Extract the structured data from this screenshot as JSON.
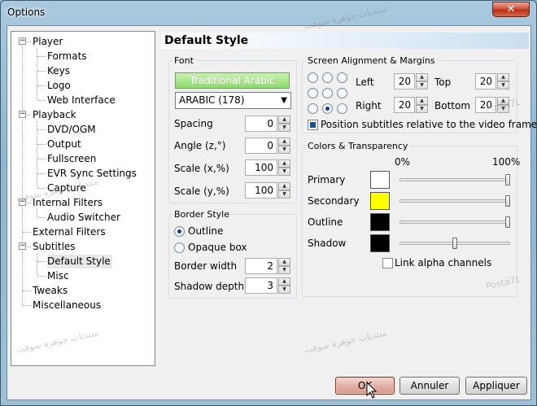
{
  "window": {
    "title": "Options",
    "close_label": "✕"
  },
  "tree": {
    "items": [
      {
        "label": "Player",
        "level": 0,
        "toggle": "−"
      },
      {
        "label": "Formats",
        "level": 1
      },
      {
        "label": "Keys",
        "level": 1
      },
      {
        "label": "Logo",
        "level": 1
      },
      {
        "label": "Web Interface",
        "level": 1
      },
      {
        "label": "Playback",
        "level": 0,
        "toggle": "−"
      },
      {
        "label": "DVD/OGM",
        "level": 1
      },
      {
        "label": "Output",
        "level": 1
      },
      {
        "label": "Fullscreen",
        "level": 1
      },
      {
        "label": "EVR Sync Settings",
        "level": 1
      },
      {
        "label": "Capture",
        "level": 1
      },
      {
        "label": "Internal Filters",
        "level": 0,
        "toggle": "−"
      },
      {
        "label": "Audio Switcher",
        "level": 1
      },
      {
        "label": "External Filters",
        "level": 0
      },
      {
        "label": "Subtitles",
        "level": 0,
        "toggle": "−"
      },
      {
        "label": "Default Style",
        "level": 1,
        "selected": true
      },
      {
        "label": "Misc",
        "level": 1
      },
      {
        "label": "Tweaks",
        "level": 0
      },
      {
        "label": "Miscellaneous",
        "level": 0
      }
    ]
  },
  "panel": {
    "title": "Default Style"
  },
  "font": {
    "legend": "Font",
    "font_button": "Traditional Arabic",
    "charset": "ARABIC (178)",
    "spacing_label": "Spacing",
    "spacing_value": "0",
    "angle_label": "Angle (z,°)",
    "angle_value": "0",
    "scale_x_label": "Scale (x,%)",
    "scale_x_value": "100",
    "scale_y_label": "Scale (y,%)",
    "scale_y_value": "100"
  },
  "border": {
    "legend": "Border Style",
    "outline_label": "Outline",
    "opaque_label": "Opaque box",
    "width_label": "Border width",
    "width_value": "2",
    "shadow_label": "Shadow depth",
    "shadow_value": "3"
  },
  "alignment": {
    "legend": "Screen Alignment & Margins",
    "left_label": "Left",
    "left_value": "20",
    "top_label": "Top",
    "top_value": "20",
    "right_label": "Right",
    "right_value": "20",
    "bottom_label": "Bottom",
    "bottom_value": "20",
    "position_label": "Position subtitles relative to the video frame"
  },
  "colors": {
    "legend": "Colors & Transparency",
    "min_label": "0%",
    "max_label": "100%",
    "primary_label": "Primary",
    "primary_color": "#ffffff",
    "primary_alpha": 1.0,
    "secondary_label": "Secondary",
    "secondary_color": "#ffff00",
    "secondary_alpha": 1.0,
    "outline_label": "Outline",
    "outline_color": "#000000",
    "outline_alpha": 1.0,
    "shadow_label": "Shadow",
    "shadow_color": "#000000",
    "shadow_alpha": 0.5,
    "link_label": "Link alpha channels"
  },
  "buttons": {
    "ok": "OK",
    "cancel": "Annuler",
    "apply": "Appliquer"
  },
  "watermark": {
    "arabic": "منتديات جوهرة سوفت",
    "latin": "Posta7L"
  }
}
